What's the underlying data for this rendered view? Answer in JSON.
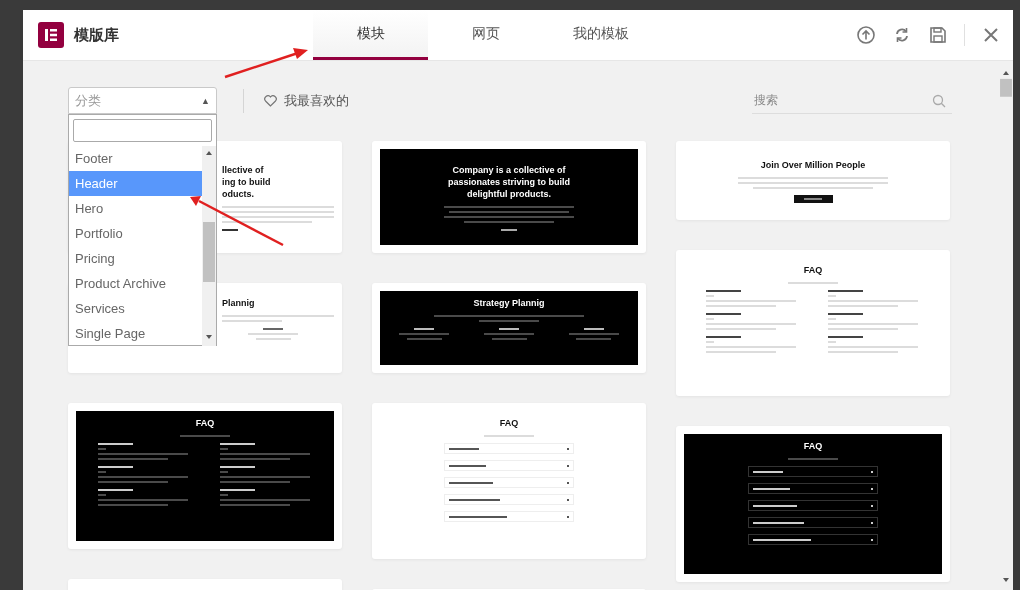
{
  "window": {
    "title": "模版库"
  },
  "tabs": [
    {
      "label": "模块",
      "selected": true
    },
    {
      "label": "网页",
      "selected": false
    },
    {
      "label": "我的模板",
      "selected": false
    }
  ],
  "toolbar": {
    "category_select": {
      "placeholder": "分类",
      "caret": "▲"
    },
    "favorites": {
      "label": "我最喜欢的"
    },
    "search": {
      "placeholder": "搜索"
    }
  },
  "category_dropdown": {
    "items": [
      {
        "label": "Footer",
        "selected": false
      },
      {
        "label": "Header",
        "selected": true
      },
      {
        "label": "Hero",
        "selected": false
      },
      {
        "label": "Portfolio",
        "selected": false
      },
      {
        "label": "Pricing",
        "selected": false
      },
      {
        "label": "Product Archive",
        "selected": false
      },
      {
        "label": "Services",
        "selected": false
      },
      {
        "label": "Single Page",
        "selected": false
      }
    ]
  },
  "template_columns": [
    [
      {
        "kind": "hero",
        "dark": false,
        "covered": true,
        "title_lines": [
          "llective of",
          "ing to build",
          "oducts."
        ]
      },
      {
        "kind": "features",
        "dark": false,
        "covered": true,
        "title_lines": [
          "Plannig"
        ]
      },
      {
        "kind": "faq_grid",
        "dark": true,
        "covered": false,
        "title_lines": [
          "FAQ"
        ]
      },
      {
        "kind": "blank"
      }
    ],
    [
      {
        "kind": "hero",
        "dark": true,
        "covered": false,
        "title_lines": [
          "Company is a collective of",
          "passionates striving to build",
          "delightful products."
        ]
      },
      {
        "kind": "features",
        "dark": true,
        "covered": false,
        "title_lines": [
          "Strategy Plannig"
        ]
      },
      {
        "kind": "faq_accordion",
        "dark": false,
        "covered": false,
        "title_lines": [
          "FAQ"
        ]
      },
      {
        "kind": "blank"
      }
    ],
    [
      {
        "kind": "cta",
        "dark": false,
        "covered": false,
        "title_lines": [
          "Join Over Million People"
        ]
      },
      {
        "kind": "faq_grid",
        "dark": false,
        "covered": false,
        "title_lines": [
          "FAQ"
        ]
      },
      {
        "kind": "faq_accordion",
        "dark": true,
        "covered": false,
        "title_lines": [
          "FAQ"
        ]
      }
    ]
  ]
}
